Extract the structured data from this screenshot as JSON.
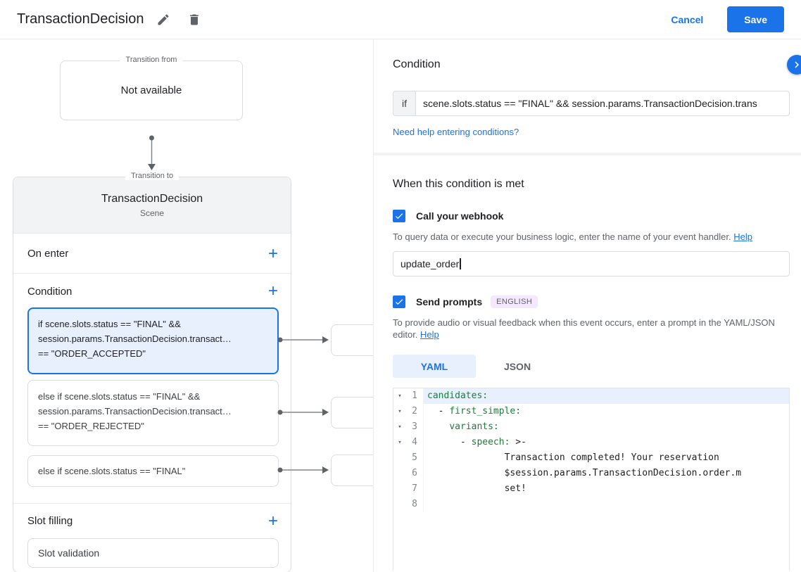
{
  "topbar": {
    "title": "TransactionDecision",
    "cancel_label": "Cancel",
    "save_label": "Save"
  },
  "canvas": {
    "transition_from": {
      "label": "Transition from",
      "content": "Not available"
    },
    "transition_to": {
      "label": "Transition to",
      "title": "TransactionDecision",
      "subtitle": "Scene"
    },
    "on_enter_label": "On enter",
    "condition_label": "Condition",
    "slot_filling_label": "Slot filling",
    "slot_validation_label": "Slot validation",
    "condition_cards": [
      {
        "selected": true,
        "lines": [
          "if scene.slots.status == \"FINAL\" &&",
          "session.params.TransactionDecision.transact…",
          "== \"ORDER_ACCEPTED\""
        ]
      },
      {
        "selected": false,
        "lines": [
          "else if scene.slots.status == \"FINAL\" &&",
          "session.params.TransactionDecision.transact…",
          "== \"ORDER_REJECTED\""
        ]
      },
      {
        "selected": false,
        "lines": [
          "else if scene.slots.status == \"FINAL\""
        ]
      }
    ]
  },
  "detail": {
    "heading": "Condition",
    "if_label": "if",
    "condition_value": "scene.slots.status == \"FINAL\" && session.params.TransactionDecision.trans",
    "conditions_help_link": "Need help entering conditions?",
    "when_met_heading": "When this condition is met",
    "webhook": {
      "label": "Call your webhook",
      "description": "To query data or execute your business logic, enter the name of your event handler.",
      "help_label": "Help",
      "value": "update_order"
    },
    "prompts": {
      "label": "Send prompts",
      "badge": "ENGLISH",
      "description": "To provide audio or visual feedback when this event occurs, enter a prompt in the YAML/JSON editor.",
      "help_label": "Help"
    },
    "tabs": {
      "yaml": "YAML",
      "json": "JSON"
    },
    "editor": {
      "lines": [
        {
          "num": "1",
          "fold": true,
          "highlight": true,
          "segments": [
            [
              "key",
              "candidates:"
            ]
          ]
        },
        {
          "num": "2",
          "fold": true,
          "highlight": false,
          "segments": [
            [
              "plain",
              "  - "
            ],
            [
              "key",
              "first_simple:"
            ]
          ]
        },
        {
          "num": "3",
          "fold": true,
          "highlight": false,
          "segments": [
            [
              "plain",
              "    "
            ],
            [
              "key",
              "variants:"
            ]
          ]
        },
        {
          "num": "4",
          "fold": true,
          "highlight": false,
          "segments": [
            [
              "plain",
              "      - "
            ],
            [
              "key",
              "speech:"
            ],
            [
              "plain",
              " >-"
            ]
          ]
        },
        {
          "num": "5",
          "fold": false,
          "highlight": false,
          "segments": [
            [
              "plain",
              "              Transaction completed! Your reservation"
            ]
          ]
        },
        {
          "num": "6",
          "fold": false,
          "highlight": false,
          "segments": [
            [
              "plain",
              "              $session.params.TransactionDecision.order.m"
            ]
          ]
        },
        {
          "num": "7",
          "fold": false,
          "highlight": false,
          "segments": [
            [
              "plain",
              "              set!"
            ]
          ]
        },
        {
          "num": "8",
          "fold": false,
          "highlight": false,
          "segments": []
        }
      ]
    },
    "colors": {
      "accent": "#1a73e8",
      "selected_bg": "#e8f0fe",
      "code_key_green": "#188038",
      "badge_bg": "#f3e8fd"
    }
  }
}
